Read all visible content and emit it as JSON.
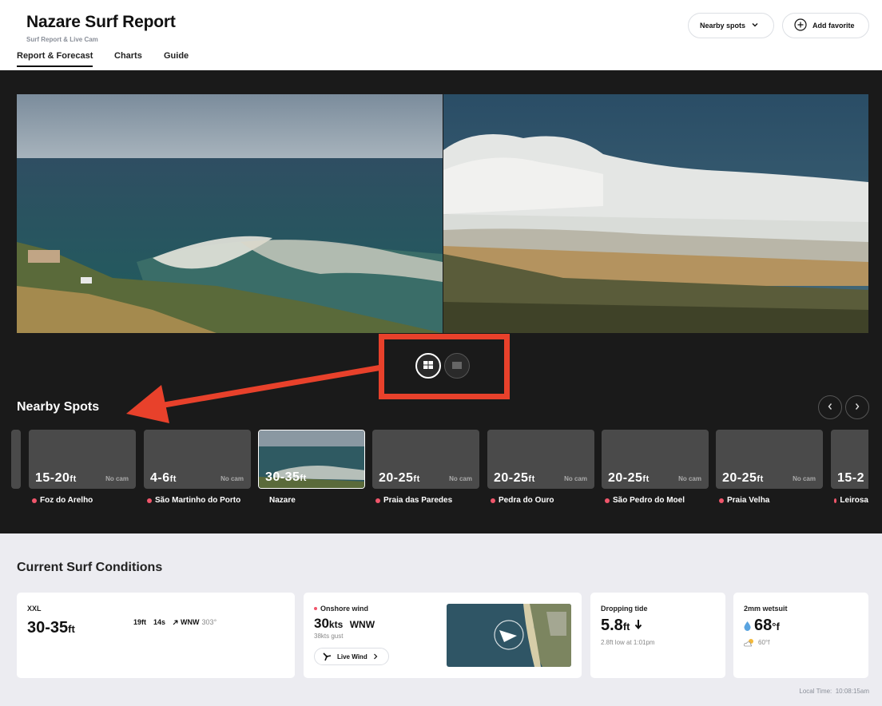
{
  "header": {
    "title": "Nazare Surf Report",
    "subtitle": "Surf Report & Live Cam",
    "tabs": [
      "Report & Forecast",
      "Charts",
      "Guide"
    ],
    "nearby_button": "Nearby spots",
    "favorite_button": "Add favorite"
  },
  "nearby": {
    "title": "Nearby Spots",
    "spots": [
      {
        "height": "15-20",
        "unit": "ft",
        "cam": "No cam",
        "name": "Foz do Arelho"
      },
      {
        "height": "4-6",
        "unit": "ft",
        "cam": "No cam",
        "name": "São Martinho do Porto"
      },
      {
        "height": "30-35",
        "unit": "ft",
        "cam": "",
        "name": "Nazare"
      },
      {
        "height": "20-25",
        "unit": "ft",
        "cam": "No cam",
        "name": "Praia das Paredes"
      },
      {
        "height": "20-25",
        "unit": "ft",
        "cam": "No cam",
        "name": "Pedra do Ouro"
      },
      {
        "height": "20-25",
        "unit": "ft",
        "cam": "No cam",
        "name": "São Pedro do Moel"
      },
      {
        "height": "20-25",
        "unit": "ft",
        "cam": "No cam",
        "name": "Praia Velha"
      },
      {
        "height": "15-2",
        "unit": "",
        "cam": "",
        "name": "Leirosa"
      }
    ]
  },
  "conditions": {
    "title": "Current Surf Conditions",
    "surf": {
      "label": "XXL",
      "value": "30-35",
      "unit": "ft",
      "swell_height": "19ft",
      "swell_period": "14s",
      "swell_dir": "WNW",
      "swell_deg": "303°"
    },
    "wind": {
      "label": "Onshore wind",
      "value": "30",
      "unit": "kts",
      "dir": "WNW",
      "gust": "38kts gust",
      "button": "Live Wind"
    },
    "tide": {
      "label": "Dropping tide",
      "value": "5.8",
      "unit": "ft",
      "detail": "2.8ft low at 1:01pm"
    },
    "water": {
      "label": "2mm wetsuit",
      "value": "68",
      "unit": "°f",
      "air": "60°f"
    },
    "local_time_label": "Local Time:",
    "local_time": "10:08:15am"
  },
  "colors": {
    "accent": "#e8412b",
    "dot": "#f0566b",
    "dark_bg": "#1a1a1a",
    "light_bg": "#ececf1"
  }
}
